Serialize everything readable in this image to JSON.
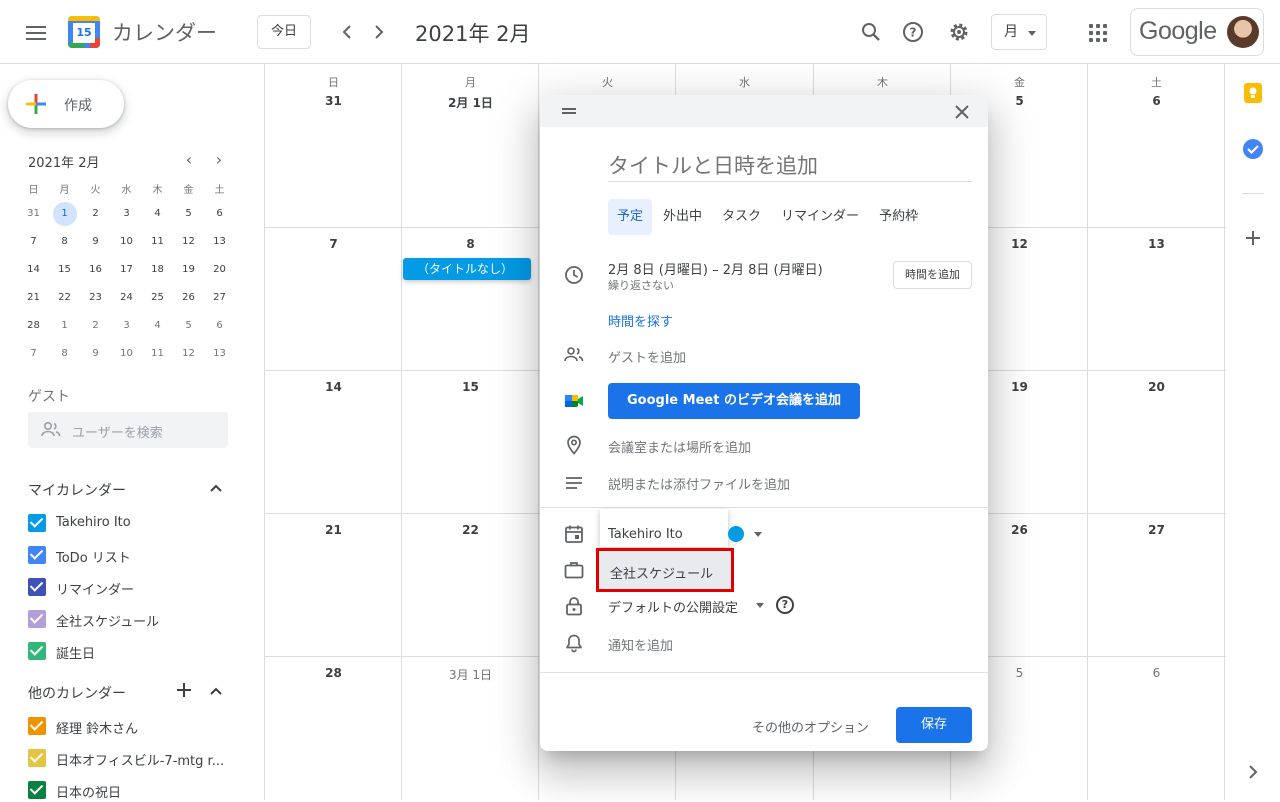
{
  "header": {
    "app_title": "カレンダー",
    "logo_day": "15",
    "today_label": "今日",
    "prev_icon": "chevron-left-icon",
    "next_icon": "chevron-right-icon",
    "month_title": "2021年 2月",
    "view_label": "月",
    "google_label": "Google"
  },
  "sidebar": {
    "create_label": "作成",
    "mini_title": "2021年 2月",
    "mini_headers": [
      "日",
      "月",
      "火",
      "水",
      "木",
      "金",
      "土"
    ],
    "mini_weeks": [
      [
        "31",
        "1",
        "2",
        "3",
        "4",
        "5",
        "6"
      ],
      [
        "7",
        "8",
        "9",
        "10",
        "11",
        "12",
        "13"
      ],
      [
        "14",
        "15",
        "16",
        "17",
        "18",
        "19",
        "20"
      ],
      [
        "21",
        "22",
        "23",
        "24",
        "25",
        "26",
        "27"
      ],
      [
        "28",
        "1",
        "2",
        "3",
        "4",
        "5",
        "6"
      ],
      [
        "7",
        "8",
        "9",
        "10",
        "11",
        "12",
        "13"
      ]
    ],
    "guest_title": "ゲスト",
    "user_search_placeholder": "ユーザーを検索",
    "my_calendars_title": "マイカレンダー",
    "my_calendars": [
      {
        "label": "Takehiro Ito",
        "color": "#039be5"
      },
      {
        "label": "ToDo リスト",
        "color": "#4285f4"
      },
      {
        "label": "リマインダー",
        "color": "#3f51b5"
      },
      {
        "label": "全社スケジュール",
        "color": "#b39ddb"
      },
      {
        "label": "誕生日",
        "color": "#33b679"
      }
    ],
    "other_calendars_title": "他のカレンダー",
    "other_calendars": [
      {
        "label": "経理 鈴木さん",
        "color": "#f09300"
      },
      {
        "label": "日本オフィスビル-7-mtg r...",
        "color": "#e4c441"
      },
      {
        "label": "日本の祝日",
        "color": "#0b8043"
      }
    ]
  },
  "grid": {
    "days_of_week": [
      "日",
      "月",
      "火",
      "水",
      "木",
      "金",
      "土"
    ],
    "weeks": [
      [
        "31",
        "2月 1日",
        "",
        "",
        "",
        "5",
        "6"
      ],
      [
        "7",
        "8",
        "",
        "",
        "",
        "12",
        "13"
      ],
      [
        "14",
        "15",
        "",
        "",
        "",
        "19",
        "20"
      ],
      [
        "21",
        "22",
        "",
        "",
        "",
        "26",
        "27"
      ],
      [
        "28",
        "3月 1日",
        "",
        "",
        "",
        "5",
        "6"
      ]
    ],
    "event_chip": "（タイトルなし）"
  },
  "dialog": {
    "title_placeholder": "タイトルと日時を追加",
    "tabs": [
      "予定",
      "外出中",
      "タスク",
      "リマインダー",
      "予約枠"
    ],
    "date_range": "2月 8日 (月曜日)  –  2月 8日 (月曜日)",
    "repeat": "繰り返さない",
    "add_time": "時間を追加",
    "find_time": "時間を探す",
    "add_guests": "ゲストを追加",
    "meet_button": "Google Meet のビデオ会議を追加",
    "add_location": "会議室または場所を追加",
    "add_description": "説明または添付ファイルを追加",
    "calendar_dropdown": "Takehiro Ito",
    "company_schedule": "全社スケジュール",
    "visibility": "デフォルトの公開設定",
    "add_notification": "通知を追加",
    "more_options": "その他のオプション",
    "save": "保存"
  }
}
